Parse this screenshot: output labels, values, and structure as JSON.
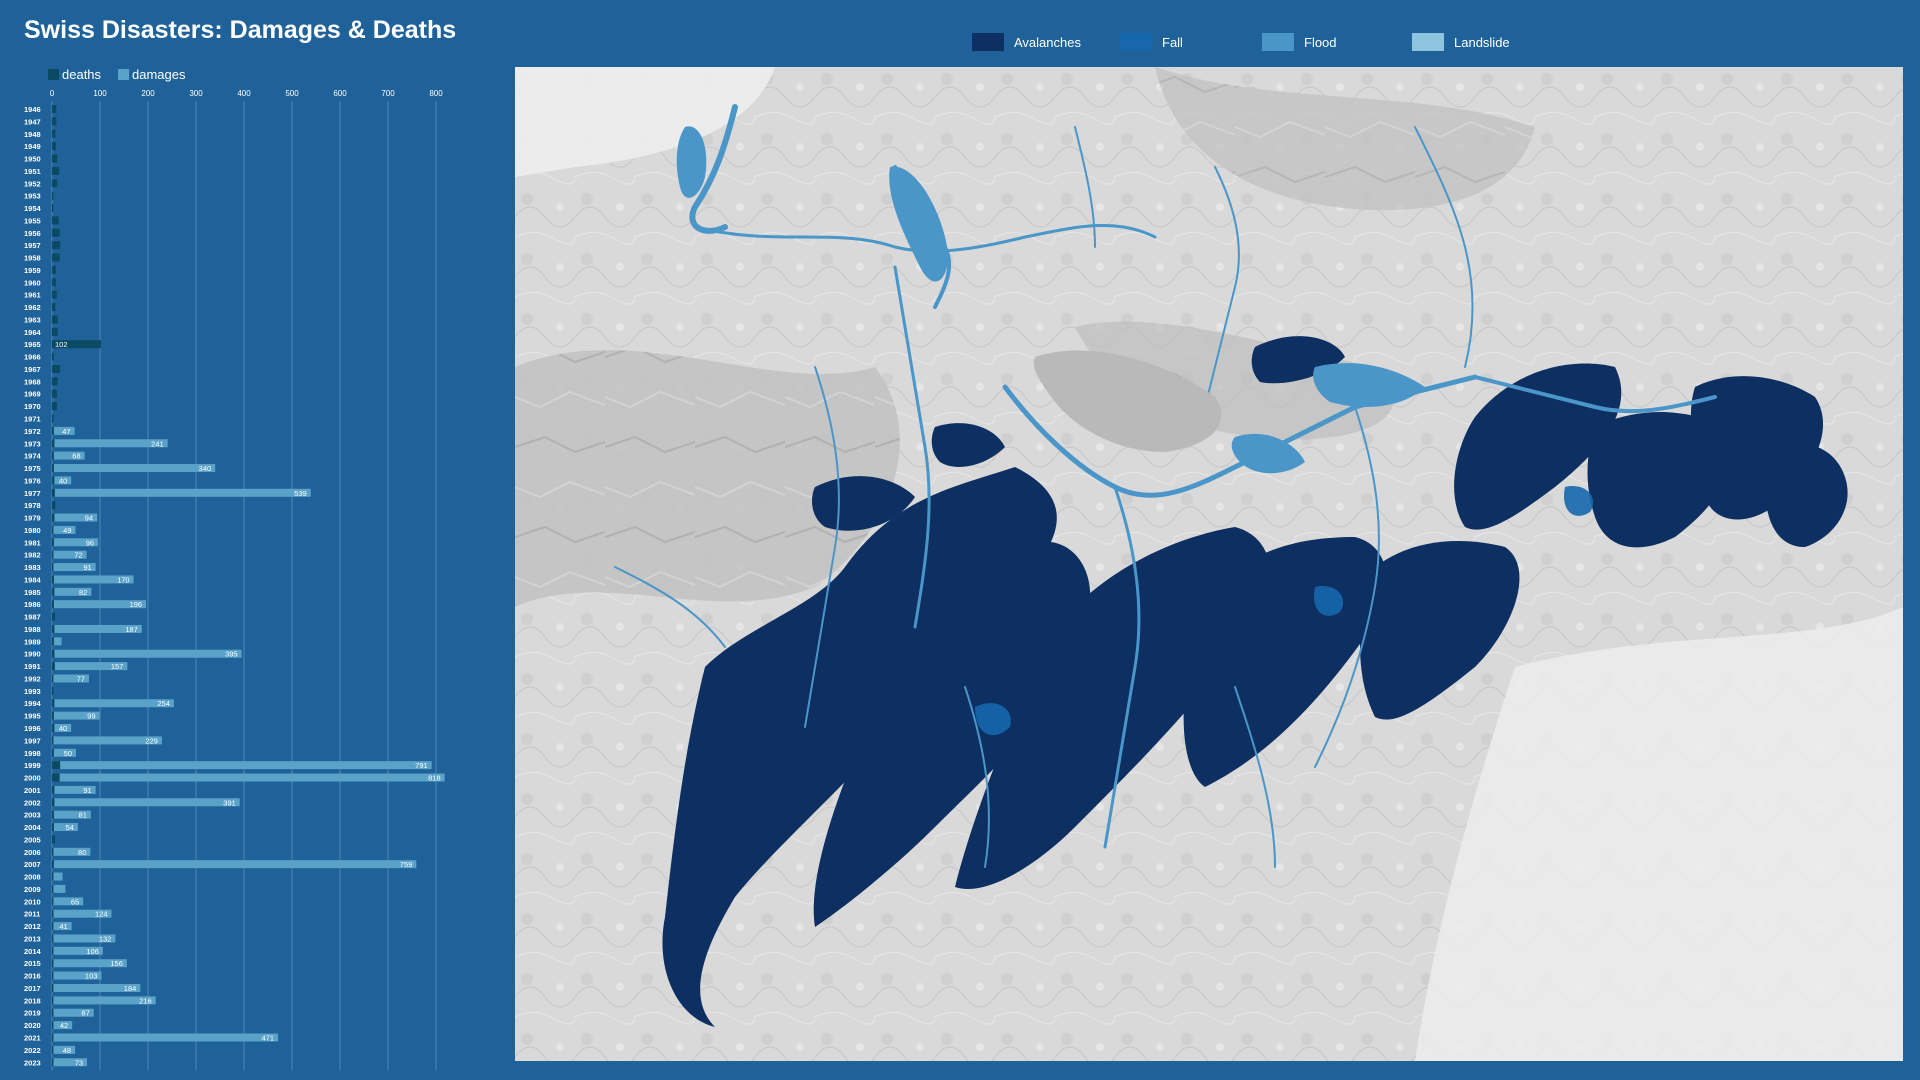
{
  "title": "Swiss Disasters: Damages & Deaths",
  "colors": {
    "background": "#1f6299",
    "deaths": "#0a4a62",
    "damages": "#5aa2c8",
    "avalanches": "#0d2f61",
    "fall": "#1667ad",
    "flood": "#4a96c8",
    "landslide": "#8ec4e0",
    "map_base": "#d8d8d8"
  },
  "map_legend": [
    {
      "label": "Avalanches",
      "color": "#0d2f61"
    },
    {
      "label": "Fall",
      "color": "#1667ad"
    },
    {
      "label": "Flood",
      "color": "#4a96c8"
    },
    {
      "label": "Landslide",
      "color": "#8ec4e0"
    }
  ],
  "chart_data": {
    "type": "bar",
    "orientation": "horizontal",
    "legend": [
      "deaths",
      "damages"
    ],
    "xlim": [
      0,
      850
    ],
    "ticks": [
      0,
      100,
      200,
      300,
      400,
      500,
      600,
      700,
      800
    ],
    "grid": true,
    "categories": [
      "1946",
      "1947",
      "1948",
      "1949",
      "1950",
      "1951",
      "1952",
      "1953",
      "1954",
      "1955",
      "1956",
      "1957",
      "1958",
      "1959",
      "1960",
      "1961",
      "1962",
      "1963",
      "1964",
      "1965",
      "1966",
      "1967",
      "1968",
      "1969",
      "1970",
      "1971",
      "1972",
      "1973",
      "1974",
      "1975",
      "1976",
      "1977",
      "1978",
      "1979",
      "1980",
      "1981",
      "1982",
      "1983",
      "1984",
      "1985",
      "1986",
      "1987",
      "1988",
      "1989",
      "1990",
      "1991",
      "1992",
      "1993",
      "1994",
      "1995",
      "1996",
      "1997",
      "1998",
      "1999",
      "2000",
      "2001",
      "2002",
      "2003",
      "2004",
      "2005",
      "2006",
      "2007",
      "2008",
      "2009",
      "2010",
      "2011",
      "2012",
      "2013",
      "2014",
      "2015",
      "2016",
      "2017",
      "2018",
      "2019",
      "2020",
      "2021",
      "2022",
      "2023"
    ],
    "series": [
      {
        "name": "deaths",
        "values": [
          9,
          9,
          7,
          8,
          11,
          15,
          11,
          3,
          3,
          14,
          16,
          17,
          16,
          8,
          8,
          10,
          7,
          12,
          12,
          102,
          4,
          17,
          12,
          10,
          10,
          3,
          4,
          5,
          4,
          4,
          5,
          6,
          7,
          5,
          3,
          4,
          3,
          3,
          4,
          5,
          4,
          6,
          5,
          4,
          5,
          6,
          3,
          3,
          5,
          4,
          5,
          3,
          4,
          17,
          16,
          5,
          5,
          4,
          4,
          6,
          3,
          4,
          3,
          3,
          3,
          3,
          3,
          3,
          3,
          3,
          3,
          3,
          3,
          3,
          3,
          3,
          3,
          3
        ]
      },
      {
        "name": "damages",
        "values": [
          0,
          0,
          0,
          0,
          0,
          0,
          0,
          0,
          0,
          0,
          0,
          0,
          0,
          0,
          0,
          0,
          0,
          0,
          0,
          0,
          0,
          0,
          0,
          0,
          0,
          0,
          47,
          241,
          68,
          340,
          40,
          539,
          0,
          94,
          49,
          96,
          72,
          91,
          170,
          82,
          196,
          0,
          187,
          20,
          395,
          157,
          77,
          0,
          254,
          99,
          40,
          229,
          50,
          791,
          818,
          91,
          391,
          81,
          54,
          0,
          80,
          759,
          22,
          28,
          65,
          124,
          41,
          132,
          106,
          156,
          103,
          184,
          216,
          87,
          42,
          471,
          48,
          73
        ]
      }
    ],
    "data_labels": {
      "deaths": {
        "1965": "102"
      },
      "damages_min_labeled": 40
    }
  }
}
